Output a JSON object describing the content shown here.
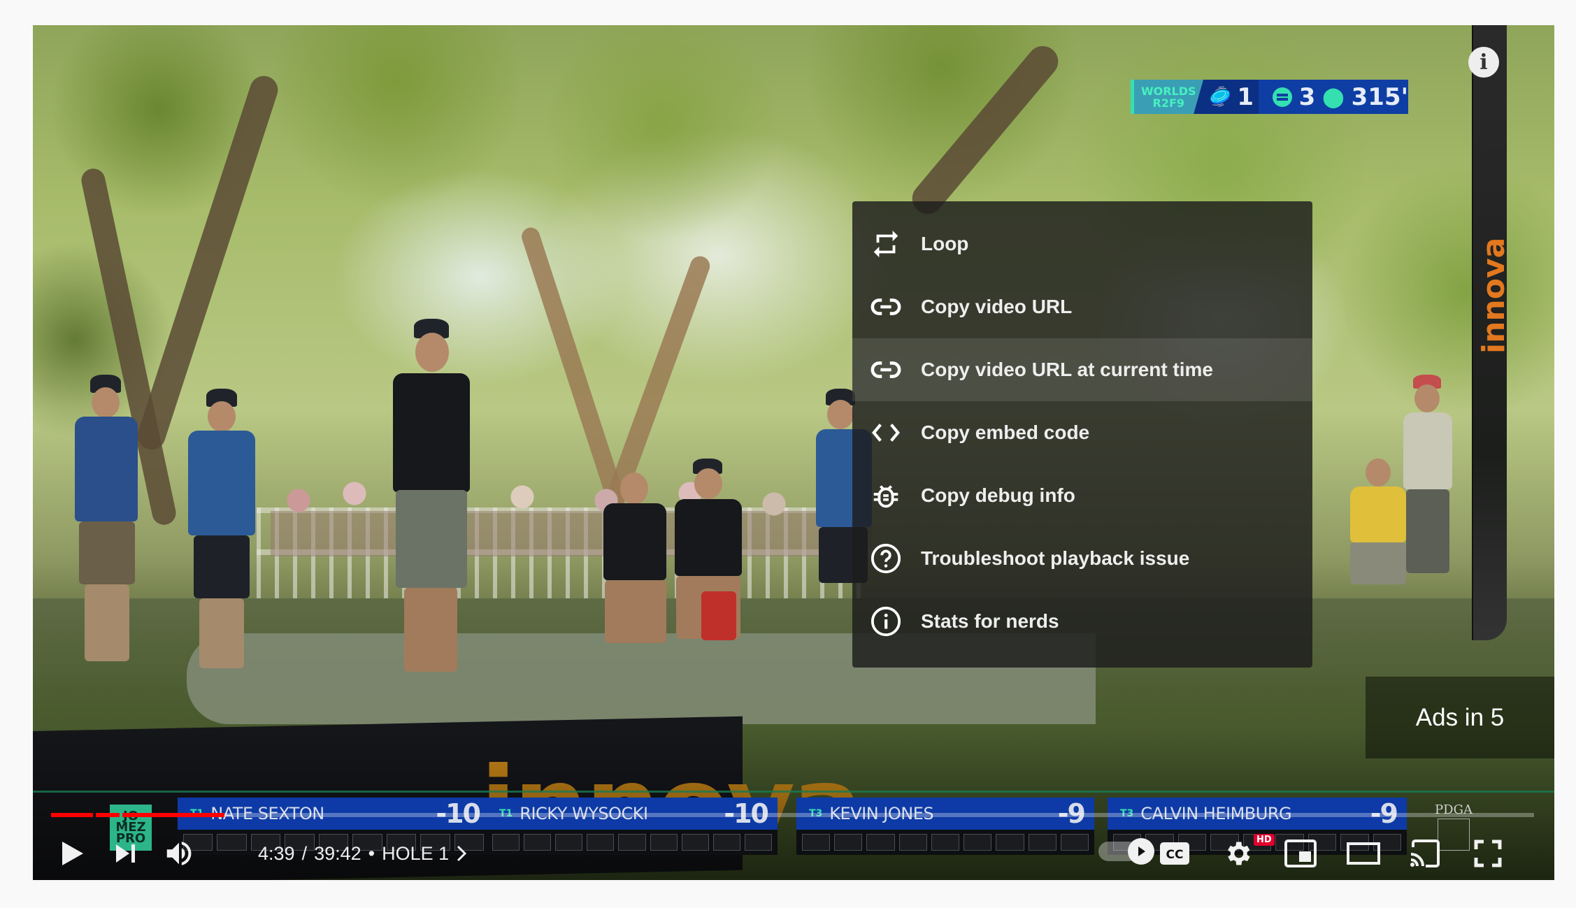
{
  "overlay": {
    "hole_bar": {
      "event_line1": "WORLDS",
      "event_line2": "R2F9",
      "hole_number": "1",
      "par": "3",
      "distance": "315'"
    },
    "ads_countdown": "Ads in 5",
    "sponsor_text": "innova",
    "leaderboard": [
      {
        "rank": "T1",
        "name": "NATE SEXTON",
        "score": "-10"
      },
      {
        "rank": "T1",
        "name": "RICKY WYSOCKI",
        "score": "-10"
      },
      {
        "rank": "T3",
        "name": "KEVIN JONES",
        "score": "-9"
      },
      {
        "rank": "T3",
        "name": "CALVIN HEIMBURG",
        "score": "-9"
      }
    ],
    "jomez_logo": [
      "JO",
      "MEZ",
      "PRO"
    ],
    "pdga_logo": "PDGA"
  },
  "context_menu": {
    "items": [
      {
        "label": "Loop",
        "icon": "loop-icon"
      },
      {
        "label": "Copy video URL",
        "icon": "link-icon"
      },
      {
        "label": "Copy video URL at current time",
        "icon": "link-icon",
        "highlighted": true
      },
      {
        "label": "Copy embed code",
        "icon": "code-icon"
      },
      {
        "label": "Copy debug info",
        "icon": "bug-icon"
      },
      {
        "label": "Troubleshoot playback issue",
        "icon": "help-circle-icon"
      },
      {
        "label": "Stats for nerds",
        "icon": "info-circle-icon"
      }
    ]
  },
  "player": {
    "current_time": "4:39",
    "separator": "/",
    "duration": "39:42",
    "chapter_dot": "•",
    "chapter": "HOLE 1",
    "progress_fraction": 0.117,
    "autoplay": "on",
    "quality_badge": "HD",
    "colors": {
      "progress_played": "#ff0000",
      "hd_badge": "#e1002d",
      "leaderboard_blue": "#0d3aa6",
      "accent_teal": "#35e0b0"
    }
  }
}
